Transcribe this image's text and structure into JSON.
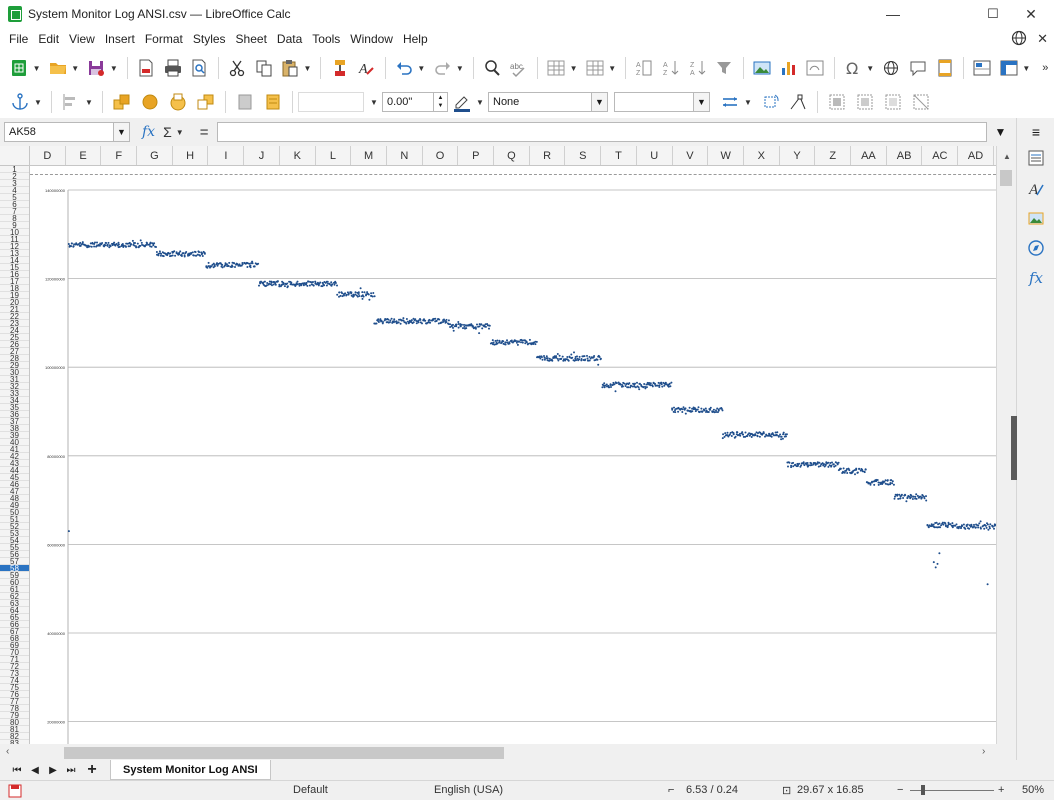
{
  "window": {
    "title": "System Monitor Log ANSI.csv — LibreOffice Calc",
    "minimize": "—",
    "maximize": "☐",
    "close": "✕"
  },
  "menu": {
    "items": [
      "File",
      "Edit",
      "View",
      "Insert",
      "Format",
      "Styles",
      "Sheet",
      "Data",
      "Tools",
      "Window",
      "Help"
    ],
    "close_doc": "✕"
  },
  "toolbar2": {
    "line_width": "0.00\"",
    "area_style": "None"
  },
  "formula": {
    "name_box": "AK58",
    "fx": "fx",
    "sigma": "Σ",
    "equals": "=",
    "content": ""
  },
  "columns": [
    "D",
    "E",
    "F",
    "G",
    "H",
    "I",
    "J",
    "K",
    "L",
    "M",
    "N",
    "O",
    "P",
    "Q",
    "R",
    "S",
    "T",
    "U",
    "V",
    "W",
    "X",
    "Y",
    "Z",
    "AA",
    "AB",
    "AC",
    "AD"
  ],
  "rows": {
    "first": 1,
    "last": 83,
    "active": 58
  },
  "sheet_tab": {
    "name": "System Monitor Log ANSI"
  },
  "status": {
    "page_style": "Default",
    "language": "English (USA)",
    "position": "6.53 / 0.24",
    "size": "29.67 x 16.85",
    "zoom": "50%"
  },
  "colors": {
    "series": "#1f4e8c",
    "accent": "#2a73c2",
    "app_green": "#1e9e3a"
  },
  "chart_data": {
    "type": "scatter",
    "yticks": [
      20000000,
      40000000,
      60000000,
      80000000,
      100000000,
      120000000,
      140000000
    ],
    "ytick_labels": [
      "20000000",
      "40000000",
      "60000000",
      "80000000",
      "100000000",
      "120000000",
      "140000000"
    ],
    "ylim": [
      14000000,
      140000000
    ],
    "xlim": [
      0,
      1000
    ],
    "grid": true,
    "segments": [
      {
        "x": [
          0,
          95
        ],
        "y": 127600000
      },
      {
        "x": [
          95,
          148
        ],
        "y": 125600000
      },
      {
        "x": [
          148,
          205
        ],
        "y": 123000000
      },
      {
        "x": [
          205,
          290
        ],
        "y": 118800000
      },
      {
        "x": [
          290,
          330
        ],
        "y": 116400000
      },
      {
        "x": [
          330,
          410
        ],
        "y": 110400000
      },
      {
        "x": [
          410,
          455
        ],
        "y": 109200000
      },
      {
        "x": [
          455,
          505
        ],
        "y": 105600000
      },
      {
        "x": [
          505,
          575
        ],
        "y": 102000000
      },
      {
        "x": [
          575,
          650
        ],
        "y": 96000000
      },
      {
        "x": [
          650,
          705
        ],
        "y": 90400000
      },
      {
        "x": [
          705,
          775
        ],
        "y": 84800000
      },
      {
        "x": [
          775,
          830
        ],
        "y": 78000000
      },
      {
        "x": [
          830,
          860
        ],
        "y": 76600000
      },
      {
        "x": [
          860,
          890
        ],
        "y": 74000000
      },
      {
        "x": [
          890,
          925
        ],
        "y": 70800000
      },
      {
        "x": [
          925,
          955
        ],
        "y": 64400000
      },
      {
        "x": [
          955,
          1000
        ],
        "y": 64000000
      }
    ],
    "outliers": [
      {
        "x": 1,
        "y": 63000000
      },
      {
        "x": 933,
        "y": 56000000
      },
      {
        "x": 935,
        "y": 54800000
      },
      {
        "x": 937,
        "y": 55600000
      },
      {
        "x": 939,
        "y": 58000000
      },
      {
        "x": 991,
        "y": 51000000
      }
    ]
  }
}
